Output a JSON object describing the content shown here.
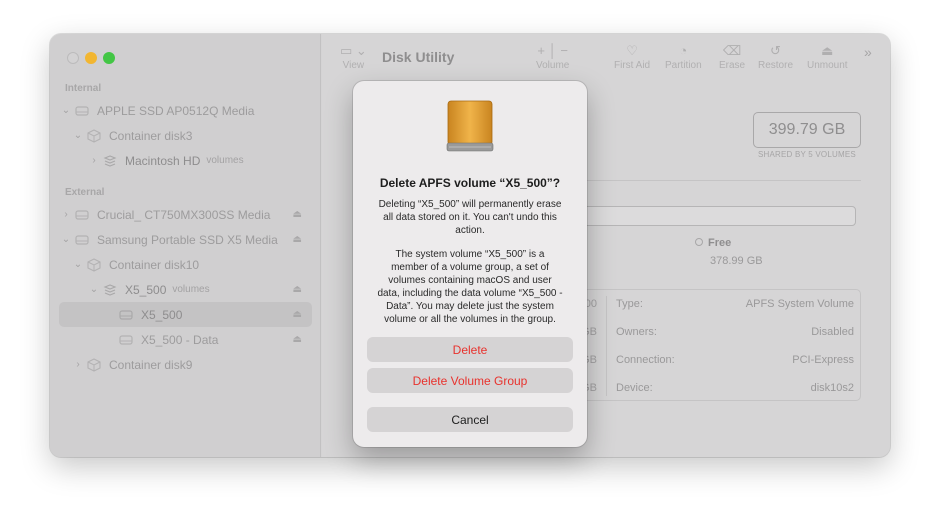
{
  "sidebar": {
    "internal_label": "Internal",
    "external_label": "External",
    "items": [
      {
        "label": "APPLE SSD AP0512Q Media",
        "tag": ""
      },
      {
        "label": "Container disk3",
        "tag": ""
      },
      {
        "label": "Macintosh HD",
        "tag": "volumes"
      },
      {
        "label": "Crucial_ CT750MX300SS Media",
        "tag": ""
      },
      {
        "label": "Samsung Portable SSD X5 Media",
        "tag": ""
      },
      {
        "label": "Container disk10",
        "tag": ""
      },
      {
        "label": "X5_500",
        "tag": "volumes"
      },
      {
        "label": "X5_500",
        "tag": ""
      },
      {
        "label": "X5_500 - Data",
        "tag": ""
      },
      {
        "label": "Container disk9",
        "tag": ""
      }
    ]
  },
  "toolbar": {
    "title": "Disk Utility",
    "view_label": "View",
    "volume_label": "Volume",
    "first_aid_label": "First Aid",
    "partition_label": "Partition",
    "erase_label": "Erase",
    "restore_label": "Restore",
    "unmount_label": "Unmount"
  },
  "volume": {
    "size": "399.79 GB",
    "shared_note": "SHARED BY 5 VOLUMES",
    "volumes_fragment": "umes",
    "free_label": "Free",
    "free_value": "378.99 GB"
  },
  "info": {
    "rows": [
      {
        "frag": "00",
        "key": "Type:",
        "value": "APFS System Volume"
      },
      {
        "frag": "GB",
        "key": "Owners:",
        "value": "Disabled"
      },
      {
        "frag": "GB",
        "key": "Connection:",
        "value": "PCI-Express"
      },
      {
        "frag": "GB",
        "key": "Device:",
        "value": "disk10s2"
      }
    ]
  },
  "dialog": {
    "title": "Delete APFS volume “X5_500”?",
    "message1": "Deleting “X5_500” will permanently erase all data stored on it. You can't undo this action.",
    "message2": "The system volume “X5_500” is a member of a volume group, a set of volumes containing macOS and user data, including the data volume “X5_500 - Data”. You may delete just the system volume or all the volumes in the group.",
    "delete_label": "Delete",
    "delete_group_label": "Delete Volume Group",
    "cancel_label": "Cancel"
  },
  "colors": {
    "destructive": "#e8322d",
    "drive_orange": "#e9a43a",
    "traffic_min": "#f2b631",
    "traffic_max": "#43c645"
  },
  "icons": {
    "disk": "external-drive-icon",
    "container": "container-icon",
    "volume_group": "stacked-volumes-icon",
    "eject": "eject-icon"
  }
}
